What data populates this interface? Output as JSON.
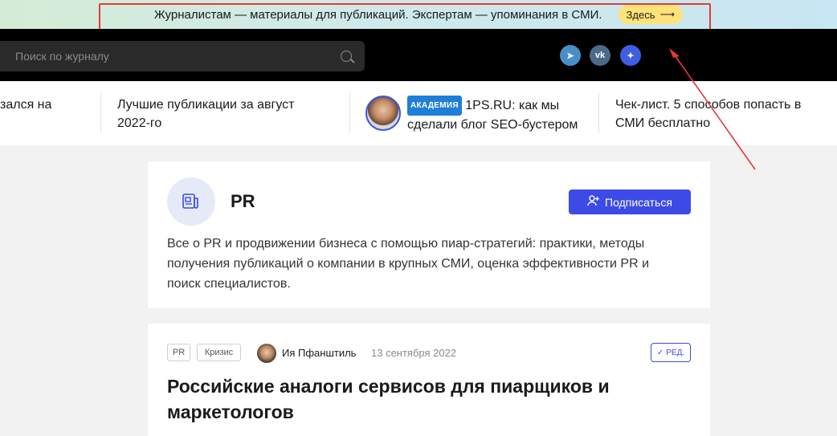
{
  "banner": {
    "text": "Журналистам — материалы для публикаций. Экспертам — упоминания в СМИ.",
    "button_label": "Здесь",
    "button_arrow": "⟶"
  },
  "header": {
    "search_placeholder": "Поиск по журналу",
    "social": [
      {
        "name": "telegram",
        "glyph": "➤"
      },
      {
        "name": "vk",
        "glyph": "vk"
      },
      {
        "name": "dzen",
        "glyph": "✦"
      }
    ]
  },
  "strip": {
    "item0": [
      "зался на",
      ""
    ],
    "item1": [
      "Лучшие публикации за август",
      "2022-го"
    ],
    "item2_badge": "АКАДЕМИЯ",
    "item2": [
      "1PS.RU: как мы",
      "сделали блог SEO-бустером"
    ],
    "item3": [
      "Чек-лист. 5 способов попасть в",
      "СМИ бесплатно"
    ]
  },
  "category": {
    "title": "PR",
    "subscribe_label": "Подписаться",
    "description": "Все о PR и продвижении бизнеса с помощью пиар-стратегий: практики, методы получения публикаций о компании в крупных СМИ, оценка эффективности PR и поиск специалистов."
  },
  "article": {
    "tags": [
      "PR",
      "Кризис"
    ],
    "author": "Ия Пфанштиль",
    "date": "13 сентября 2022",
    "ed_label": "РЕД.",
    "title": "Российские аналоги сервисов для пиарщиков и маркетологов"
  },
  "colors": {
    "accent": "#3d4be6",
    "banner_button": "#ffe27a",
    "annotation": "#e53935"
  }
}
